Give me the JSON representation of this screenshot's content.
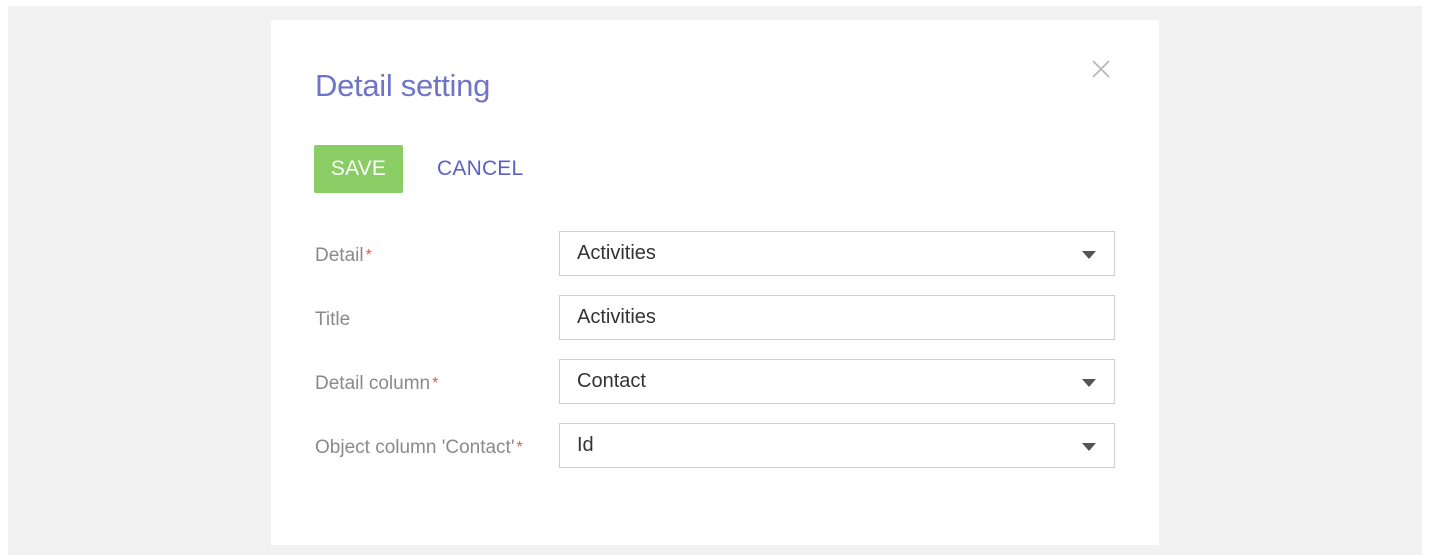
{
  "dialog": {
    "title": "Detail setting",
    "close_icon": "close-icon"
  },
  "toolbar": {
    "save_label": "SAVE",
    "cancel_label": "CANCEL"
  },
  "form": {
    "fields": [
      {
        "label": "Detail",
        "required": true,
        "value": "Activities",
        "type": "dropdown"
      },
      {
        "label": "Title",
        "required": false,
        "value": "Activities",
        "type": "text"
      },
      {
        "label": "Detail column",
        "required": true,
        "value": "Contact",
        "type": "dropdown"
      },
      {
        "label": "Object column 'Contact'",
        "required": true,
        "value": "Id",
        "type": "dropdown"
      }
    ],
    "required_marker": "*",
    "dropdown_icon": "caret-down-icon"
  },
  "colors": {
    "title": "#6f74c9",
    "save_button": "#8acd64",
    "cancel_link": "#5b61c3",
    "required_marker": "#e5573c",
    "label": "#8a8a8a"
  }
}
